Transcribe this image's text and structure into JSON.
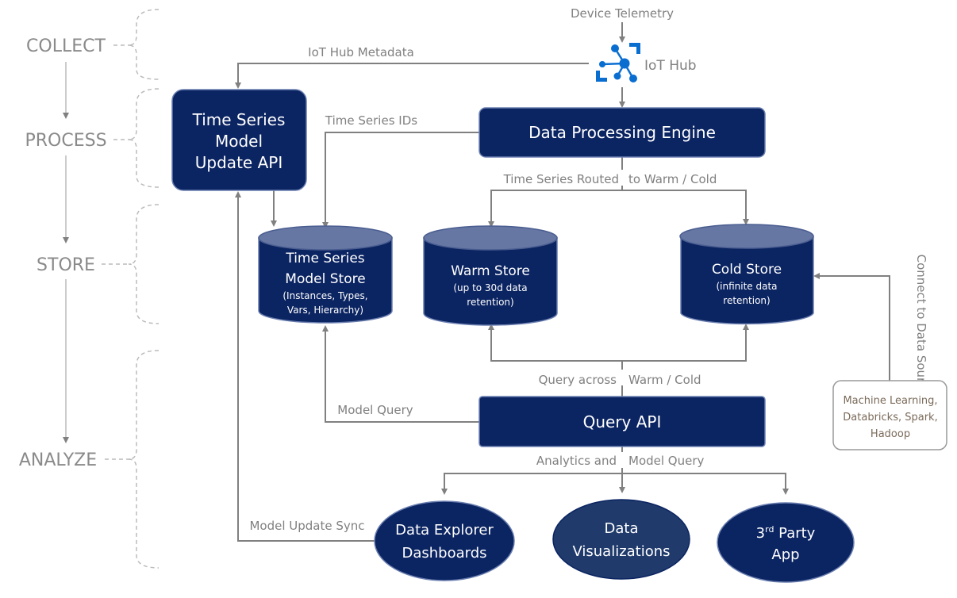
{
  "stages": [
    "COLLECT",
    "PROCESS",
    "STORE",
    "ANALYZE"
  ],
  "inputs": {
    "device_telemetry": "Device Telemetry",
    "iot_hub": "IoT Hub"
  },
  "edges": {
    "iot_hub_metadata": "IoT Hub Metadata",
    "time_series_ids": "Time Series IDs",
    "routed_a": "Time Series Routed",
    "routed_b": "to Warm / Cold",
    "query_a": "Query across",
    "query_b": "Warm / Cold",
    "model_query": "Model Query",
    "analytics_a": "Analytics and",
    "analytics_b": "Model Query",
    "model_update_sync": "Model Update Sync",
    "connect": "Connect to Data Source"
  },
  "nodes": {
    "tsm_update_api": [
      "Time Series",
      "Model",
      "Update API"
    ],
    "data_processing_engine": "Data Processing Engine",
    "tsm_store": {
      "title": [
        "Time Series",
        "Model Store"
      ],
      "sub": [
        "(Instances, Types,",
        "Vars, Hierarchy)"
      ]
    },
    "warm_store": {
      "title": "Warm Store",
      "sub": [
        "(up to 30d data",
        "retention)"
      ]
    },
    "cold_store": {
      "title": "Cold Store",
      "sub": [
        "(infinite data",
        "retention)"
      ]
    },
    "query_api": "Query API",
    "external": [
      "Machine Learning,",
      "Databricks, Spark,",
      "Hadoop"
    ],
    "data_explorer": [
      "Data Explorer",
      "Dashboards"
    ],
    "data_viz": [
      "Data",
      "Visualizations"
    ],
    "third_party": {
      "pre": "3",
      "sup": "rd",
      "post": " Party",
      "line2": "App"
    }
  },
  "colors": {
    "navy": "#0b2462",
    "cylinder_top": "#6677a3",
    "viz": "#1f3a6b",
    "line": "#808080",
    "iot_blue": "#0a6ed1"
  }
}
